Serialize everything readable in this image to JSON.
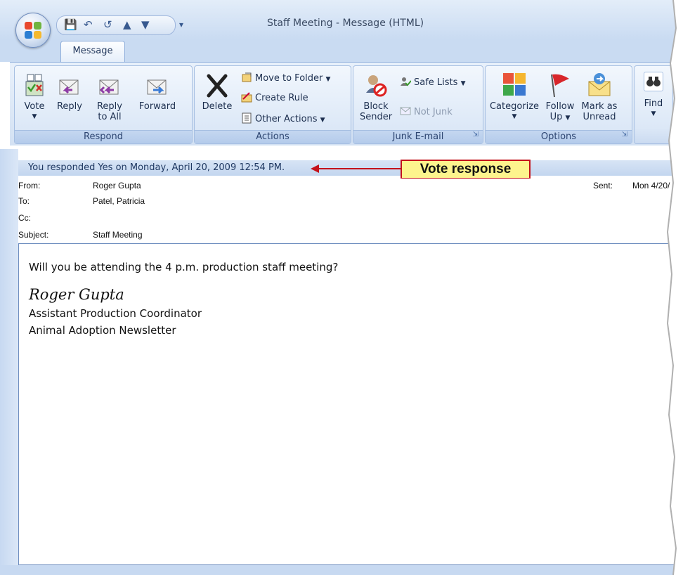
{
  "window": {
    "title": "Staff Meeting - Message (HTML)"
  },
  "tabs": [
    {
      "label": "Message"
    }
  ],
  "ribbon": {
    "respond": {
      "label": "Respond",
      "vote": "Vote",
      "reply": "Reply",
      "reply_all_line1": "Reply",
      "reply_all_line2": "to All",
      "forward": "Forward"
    },
    "actions": {
      "label": "Actions",
      "delete": "Delete",
      "move_to_folder": "Move to Folder",
      "create_rule": "Create Rule",
      "other_actions": "Other Actions"
    },
    "junk": {
      "label": "Junk E-mail",
      "block_line1": "Block",
      "block_line2": "Sender",
      "safe_lists": "Safe Lists",
      "not_junk": "Not Junk"
    },
    "options": {
      "label": "Options",
      "categorize": "Categorize",
      "follow_line1": "Follow",
      "follow_line2": "Up",
      "mark_line1": "Mark as",
      "mark_line2": "Unread"
    },
    "find": {
      "label": "Find"
    }
  },
  "infobar": {
    "text": "You responded Yes on Monday, April 20, 2009 12:54 PM."
  },
  "callout": {
    "text": "Vote response"
  },
  "header": {
    "from_label": "From:",
    "from": "Roger Gupta",
    "to_label": "To:",
    "to": "Patel, Patricia",
    "cc_label": "Cc:",
    "cc": "",
    "subject_label": "Subject:",
    "subject": "Staff Meeting",
    "sent_label": "Sent:",
    "sent": "Mon 4/20/"
  },
  "body": {
    "line1": "Will you be attending the 4 p.m. production staff meeting?",
    "signature": "Roger Gupta",
    "title": "Assistant Production Coordinator",
    "org": "Animal Adoption Newsletter"
  }
}
